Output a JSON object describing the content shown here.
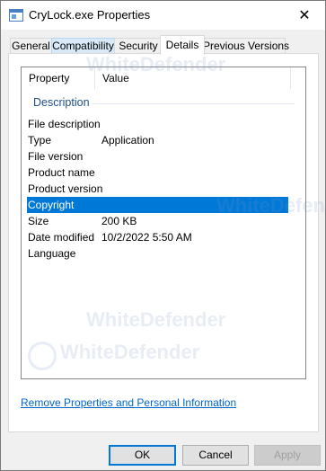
{
  "window": {
    "title": "CryLock.exe Properties",
    "close_glyph": "✕"
  },
  "tabs": [
    {
      "label": "General"
    },
    {
      "label": "Compatibility"
    },
    {
      "label": "Security"
    },
    {
      "label": "Details"
    },
    {
      "label": "Previous Versions"
    }
  ],
  "selected_tab": "Details",
  "details": {
    "columns": [
      "Property",
      "Value"
    ],
    "group": "Description",
    "rows": [
      {
        "key": "File description",
        "value": ""
      },
      {
        "key": "Type",
        "value": "Application"
      },
      {
        "key": "File version",
        "value": ""
      },
      {
        "key": "Product name",
        "value": ""
      },
      {
        "key": "Product version",
        "value": ""
      },
      {
        "key": "Copyright",
        "value": ""
      },
      {
        "key": "Size",
        "value": "200 KB"
      },
      {
        "key": "Date modified",
        "value": "10/2/2022 5:50 AM"
      },
      {
        "key": "Language",
        "value": ""
      }
    ],
    "selected_row": "Copyright"
  },
  "remove_link": "Remove Properties and Personal Information",
  "buttons": {
    "ok": "OK",
    "cancel": "Cancel",
    "apply": "Apply"
  },
  "watermark": "WhiteDefender",
  "colors": {
    "selection": "#0078d7",
    "link": "#0066cc",
    "group_header": "#1e4e8c"
  }
}
